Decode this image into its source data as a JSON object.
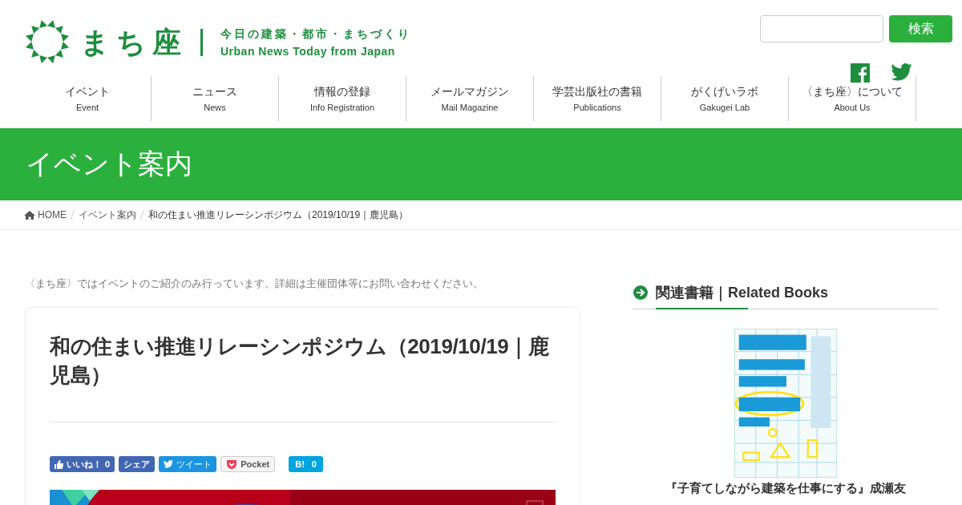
{
  "header": {
    "logo": {
      "name": "まち座",
      "tagline_ja": "今日の建築・都市・まちづくり",
      "tagline_en": "Urban News Today from Japan"
    },
    "search": {
      "button": "検索"
    },
    "nav": [
      {
        "label": "イベント",
        "sub": "Event"
      },
      {
        "label": "ニュース",
        "sub": "News"
      },
      {
        "label": "情報の登録",
        "sub": "Info Registration"
      },
      {
        "label": "メールマガジン",
        "sub": "Mail Magazine"
      },
      {
        "label": "学芸出版社の書籍",
        "sub": "Publications"
      },
      {
        "label": "がくげいラボ",
        "sub": "Gakugei Lab"
      },
      {
        "label": "〈まち座〉について",
        "sub": "About Us"
      }
    ]
  },
  "page_title": "イベント案内",
  "breadcrumb": [
    "HOME",
    "イベント案内",
    "和の住まい推進リレーシンポジウム（2019/10/19｜鹿児島）"
  ],
  "notice": "〈まち座〉ではイベントのご紹介のみ行っています。詳細は主催団体等にお問い合わせください。",
  "article": {
    "title": "和の住まい推進リレーシンポジウム（2019/10/19｜鹿児島）",
    "share": [
      {
        "kind": "like",
        "label": "いいね！",
        "count": "0"
      },
      {
        "kind": "share",
        "label": "シェア"
      },
      {
        "kind": "tweet",
        "label": "ツイート"
      },
      {
        "kind": "pocket",
        "label": "Pocket"
      },
      {
        "kind": "hatena",
        "label": "B!",
        "count": "0"
      }
    ]
  },
  "sidebar": {
    "heading": "関連書籍｜Related Books",
    "book": {
      "title": "『子育てしながら建築を仕事にする』成瀬友"
    }
  }
}
